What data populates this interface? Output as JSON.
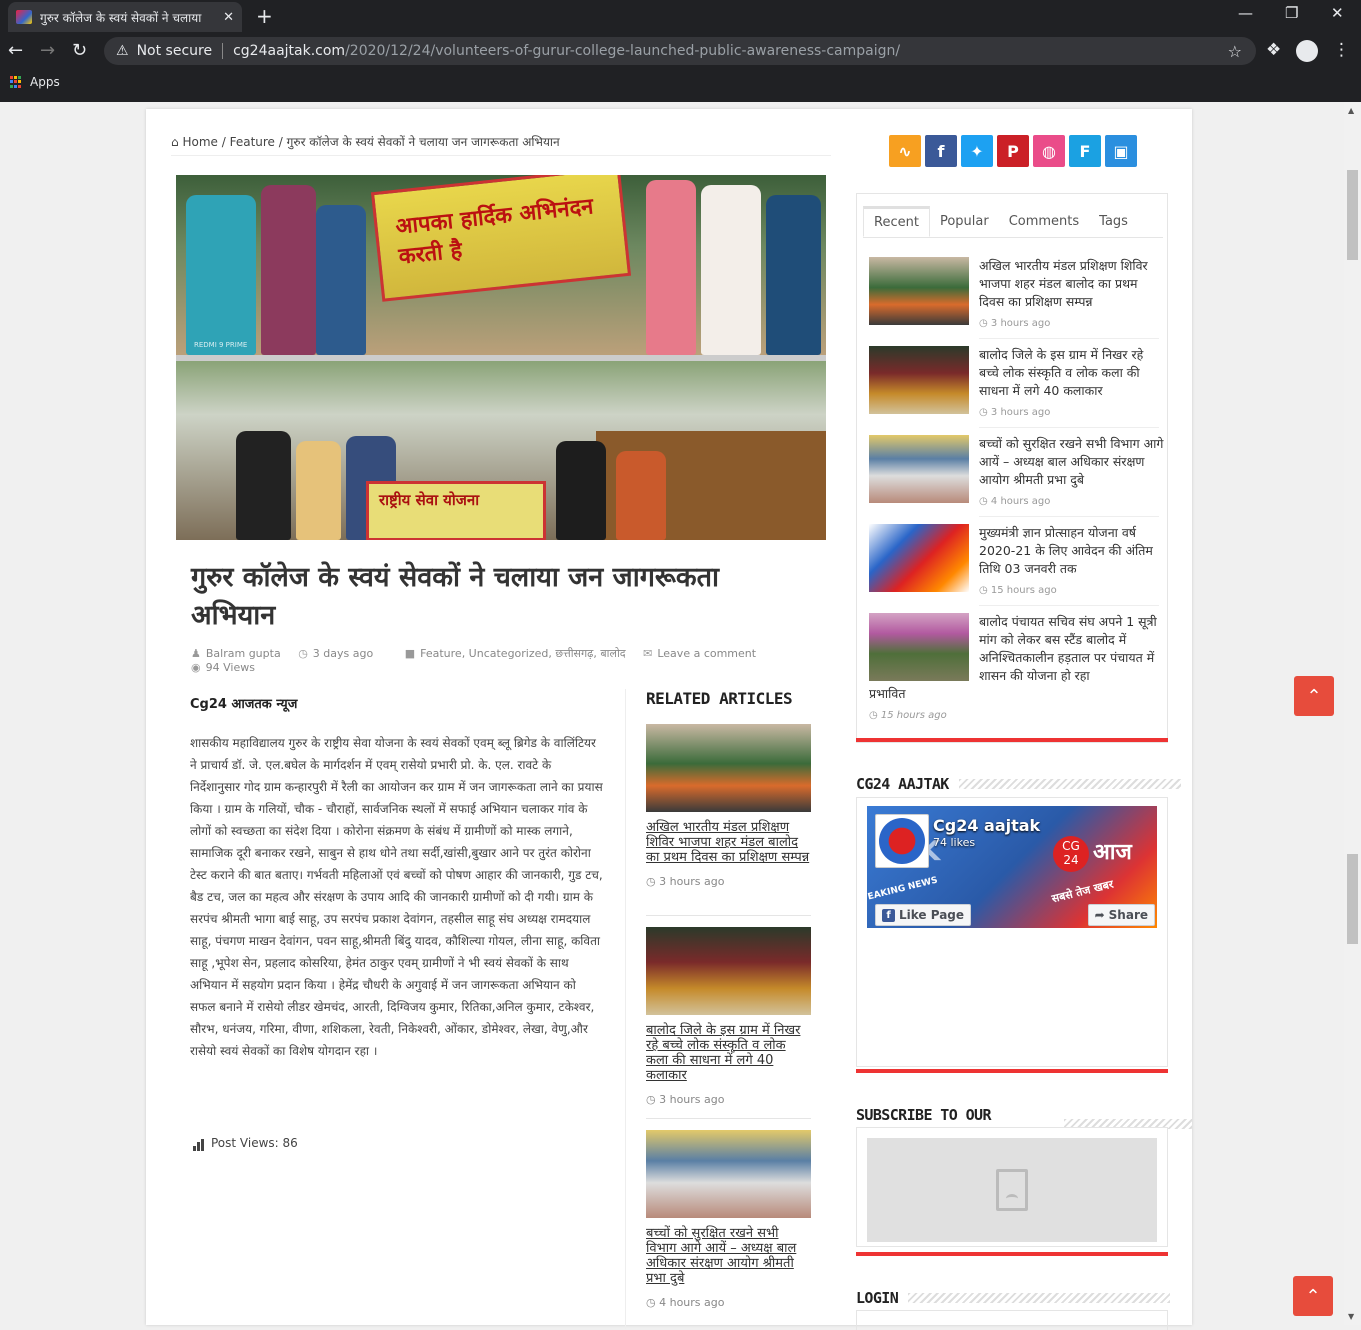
{
  "browser": {
    "tab_title": "गुरुर कॉलेज के स्वयं सेवकों ने चलाया",
    "tab_close": "✕",
    "new_tab": "+",
    "not_secure": "Not secure",
    "url_host": "cg24aajtak.com",
    "url_path": "/2020/12/24/volunteers-of-gurur-college-launched-public-awareness-campaign/",
    "apps_label": "Apps"
  },
  "breadcrumb": {
    "home": "Home",
    "sep1": "/",
    "feature": "Feature",
    "sep2": "/",
    "current": "गुरुर कॉलेज के स्वयं सेवकों ने चलाया जन जागरूकता अभियान"
  },
  "hero": {
    "banner_top": "आपका हार्दिक अभिनंदन करती है",
    "banner_bottom": "राष्ट्रीय सेवा योजना",
    "watermark": "REDMI 9 PRIME"
  },
  "article": {
    "title": "गुरुर कॉलेज के स्वयं सेवकों ने चलाया जन जागरूकता अभियान",
    "author": "Balram gupta",
    "date": "3 days ago",
    "categories": "Feature, Uncategorized, छत्तीसगढ़, बालोद",
    "comment_link": "Leave a comment",
    "views": "94 Views",
    "source": "Cg24 आजतक न्यूज",
    "body": "शासकीय महाविद्यालय गुरुर के राष्ट्रीय सेवा योजना के स्वयं सेवकों एवम् ब्लू ब्रिगेड के वालिंटियर ने प्राचार्य डॉ. जे. एल.बघेल के मार्गदर्शन में एवम् रासेयो प्रभारी प्रो. के. एल. रावटे के निर्देशानुसार गोद ग्राम कन्हारपुरी में रैली का आयोजन कर ग्राम में जन जागरूकता लाने का प्रयास किया । ग्राम के गलियों, चौक - चौराहों, सार्वजनिक स्थलों में सफाई अभियान चलाकर गांव के लोगों को स्वच्छता का संदेश दिया । कोरोना संक्रमण के संबंध में ग्रामीणों को मास्क लगाने, सामाजिक दूरी बनाकर रखने, साबुन से हाथ धोने तथा सर्दी,खांसी,बुखार आने पर तुरंत कोरोना टेस्ट कराने की बात बताए। गर्भवती महिलाओं एवं बच्चों को पोषण आहार की जानकारी, गुड टच, बैड टच, जल का महत्व और संरक्षण के उपाय आदि की जानकारी ग्रामीणों को दी गयी। ग्राम के सरपंच श्रीमती भागा बाई साहू, उप सरपंच प्रकाश देवांगन, तहसील साहू संघ अध्यक्ष रामदयाल साहू, पंचगण माखन देवांगन, पवन साहू,श्रीमती बिंदु यादव, कौशिल्या गोयल, लीना साहू, कविता साहू ,भूपेश सेन, प्रहलाद कोसरिया, हेमंत ठाकुर एवम् ग्रामीणों ने भी स्वयं सेवकों के साथ अभियान में सहयोग प्रदान किया । हेमेंद्र चौधरी के अगुवाई में जन जागरूकता अभियान को सफल बनाने में रासेयो लीडर खेमचंद, आरती, दिग्विजय कुमार, रितिका,अनिल कुमार, टकेश्वर, सौरभ, धनंजय, गरिमा, वीणा, शशिकला, रेवती, निकेश्वरी, ओंकार, डोमेश्वर, लेखा, वेणु,और रासेयो स्वयं सेवकों का विशेष योगदान रहा ।",
    "post_views": "Post Views: 86"
  },
  "related": {
    "heading": "RELATED ARTICLES",
    "items": [
      {
        "title": "अखिल भारतीय मंडल प्रशिक्षण शिविर भाजपा शहर मंडल बालोद का प्रथम दिवस का प्रशिक्षण सम्पन्न",
        "time": "3 hours ago"
      },
      {
        "title": "बालोद जिले के इस ग्राम में निखर रहे बच्चे लोक संस्कृति व लोक कला की साधना में लगे 40 कलाकार",
        "time": "3 hours ago"
      },
      {
        "title": "बच्चों को सुरक्षित रखने सभी विभाग आगे आयें – अध्यक्ष बाल अधिकार संरक्षण आयोग श्रीमती प्रभा दुबे",
        "time": "4 hours ago"
      }
    ]
  },
  "sidebar": {
    "tabs": [
      "Recent",
      "Popular",
      "Comments",
      "Tags"
    ],
    "recent": [
      {
        "title": "अखिल भारतीय मंडल प्रशिक्षण शिविर भाजपा शहर मंडल बालोद का प्रथम दिवस का प्रशिक्षण सम्पन्न",
        "time": "3 hours ago"
      },
      {
        "title": "बालोद जिले के इस ग्राम में निखर रहे बच्चे लोक संस्कृति व लोक कला की साधना में लगे 40 कलाकार",
        "time": "3 hours ago"
      },
      {
        "title": "बच्चों को सुरक्षित रखने सभी विभाग आगे आयें – अध्यक्ष बाल अधिकार संरक्षण आयोग श्रीमती प्रभा दुबे",
        "time": "4 hours ago"
      },
      {
        "title": "मुख्यमंत्री ज्ञान प्रोत्साहन योजना वर्ष 2020-21 के लिए आवेदन की अंतिम तिथि 03 जनवरी तक",
        "time": "15 hours ago"
      },
      {
        "title": "बालोद पंचायत सचिव संघ अपने 1 सूत्री मांग को लेकर बस स्टैंड बालोद में अनिश्चितकालीन हड़ताल पर पंचायत में शासन की योजना हो रहा",
        "title_tail": "प्रभावित",
        "time": "15 hours ago"
      }
    ],
    "fb_heading": "CG24 AAJTAK",
    "fb_page_name": "Cg24 aajtak",
    "fb_likes": "74 likes",
    "fb_like_btn": "Like Page",
    "fb_share_btn": "Share",
    "fb_cover_left": "AK",
    "fb_cover_cg": "CG",
    "fb_cover_24": "24",
    "fb_cover_aaj": "आज",
    "fb_cover_news": "EAKING NEWS",
    "fb_cover_slogan": "सबसे तेज खबर",
    "yt_heading": "SUBSCRIBE TO OUR CHANNEL",
    "login_heading": "LOGIN"
  },
  "colors": {
    "rss": "#f7a021",
    "facebook": "#3b5998",
    "twitter": "#1da1f2",
    "pinterest": "#cb2027",
    "dribbble": "#ea4c89",
    "foursquare": "#1ba1e2",
    "instagram": "#2b8fdf",
    "accent_red": "#e33333"
  }
}
